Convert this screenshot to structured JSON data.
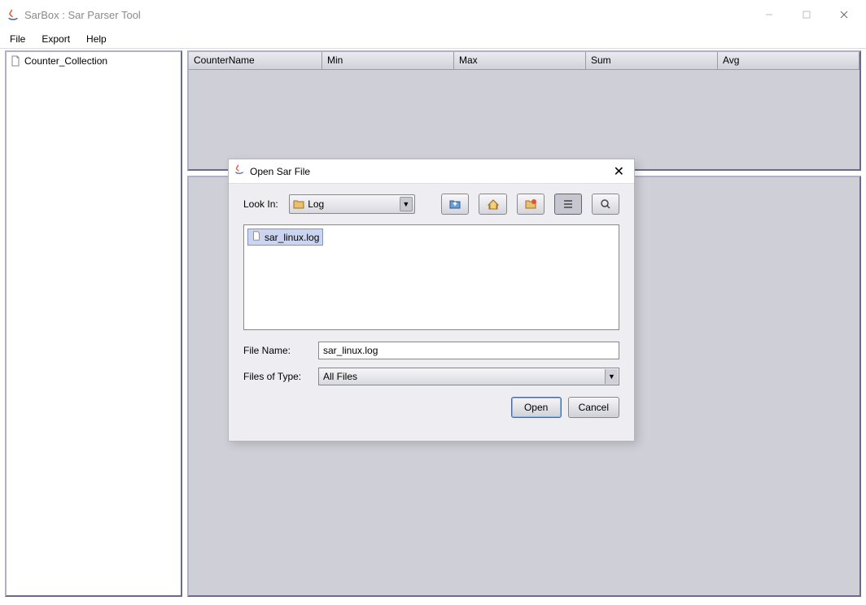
{
  "window": {
    "title": "SarBox : Sar Parser Tool"
  },
  "menu": {
    "file": "File",
    "export": "Export",
    "help": "Help"
  },
  "tree": {
    "root": "Counter_Collection"
  },
  "table": {
    "headers": [
      "CounterName",
      "Min",
      "Max",
      "Sum",
      "Avg"
    ]
  },
  "dialog": {
    "title": "Open Sar File",
    "look_in_label": "Look In:",
    "look_in_value": "Log",
    "toolbar_icons": [
      "folder-up-icon",
      "home-icon",
      "new-folder-icon",
      "list-view-icon",
      "detail-view-icon"
    ],
    "files": [
      "sar_linux.log"
    ],
    "file_name_label": "File Name:",
    "file_name_value": "sar_linux.log",
    "file_type_label": "Files of Type:",
    "file_type_value": "All Files",
    "open_label": "Open",
    "cancel_label": "Cancel"
  }
}
